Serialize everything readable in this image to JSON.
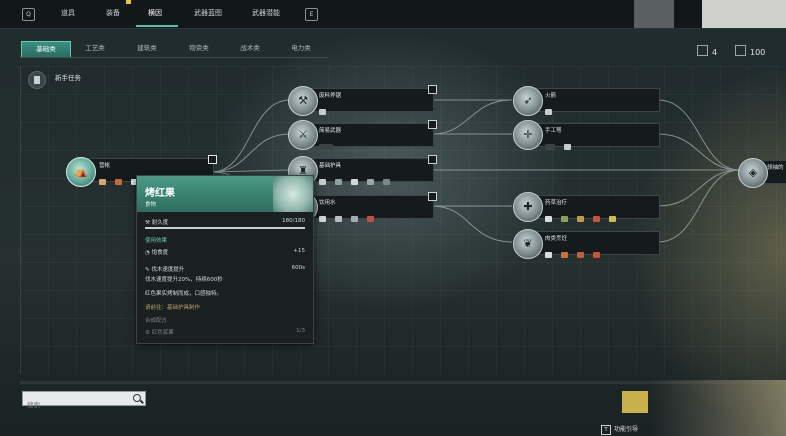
{
  "topnav": {
    "left_key": "Q",
    "right_key": "E",
    "tabs": [
      "道具",
      "装备",
      "横因",
      "武器蓝图",
      "武器潜能"
    ],
    "active_index": 2
  },
  "categories": {
    "items": [
      "基础类",
      "工艺类",
      "建筑类",
      "物资类",
      "战术类",
      "电力类"
    ],
    "active_index": 0
  },
  "resources": {
    "points": "4",
    "coins": "100"
  },
  "tree": {
    "title": "新手任务",
    "root": {
      "label": "营帐"
    },
    "col2": [
      {
        "label": "废料斧锯"
      },
      {
        "label": "简易武器"
      },
      {
        "label": "基础护具"
      },
      {
        "label": "饮用水"
      }
    ],
    "col3": [
      {
        "label": "火箭"
      },
      {
        "label": "手工弩"
      },
      {
        "label": "药草治疗"
      },
      {
        "label": "肉类烹饪"
      }
    ],
    "end": {
      "label": "领袖的"
    }
  },
  "tooltip": {
    "title": "烤红果",
    "subtitle": "食物",
    "durability_label": "耐久度",
    "durability_value": "180/180",
    "use_effect_label": "使用效果",
    "satiety_label": "饱食度",
    "satiety_value": "+15",
    "buff_label": "伐木速度提升",
    "buff_value": "600s",
    "buff_desc": "伐木速度提升20%，持续600秒",
    "flavor": "红色果实烤制而成，口感独特。",
    "unlock_hint": "请前往：基础护具制作",
    "recipe_label": "合成配方",
    "recipe_item": "红色浆果",
    "recipe_count": "1/3"
  },
  "search": {
    "placeholder": "搜索"
  },
  "footer": {
    "guide_key": "T",
    "guide_label": "功能引导"
  },
  "colors": {
    "accent": "#4fc3b0",
    "tooltip_header": "#3f8a77",
    "gold": "#c9b14a"
  }
}
